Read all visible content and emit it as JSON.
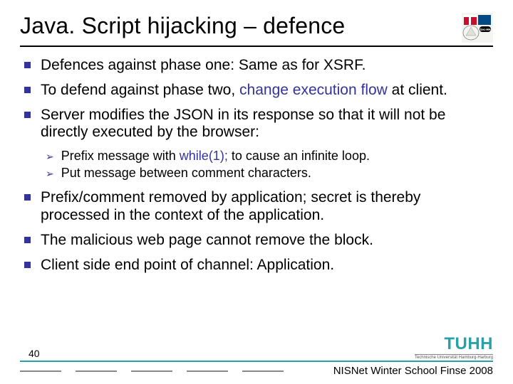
{
  "title": "Java. Script hijacking – defence",
  "bullets": [
    {
      "pre": "Defences against phase one: Same as for XSRF.",
      "accent": "",
      "post": ""
    },
    {
      "pre": "To defend against phase two, ",
      "accent": "change execution flow",
      "post": " at client."
    },
    {
      "pre": "Server modifies the JSON in its response so that it will not be directly executed by the browser:",
      "accent": "",
      "post": ""
    }
  ],
  "sub_bullets": [
    {
      "pre": "Prefix message with ",
      "accent": "while(1);",
      "post": " to cause an infinite loop."
    },
    {
      "pre": "Put message between comment characters.",
      "accent": "",
      "post": ""
    }
  ],
  "bullets2": [
    {
      "pre": "Prefix/comment removed by application; secret is thereby processed in the context of the application.",
      "accent": "",
      "post": ""
    },
    {
      "pre": "The malicious web page cannot remove the block.",
      "accent": "",
      "post": ""
    },
    {
      "pre": "Client side end point of channel: Application.",
      "accent": "",
      "post": ""
    }
  ],
  "page_number": "40",
  "footer_event": "NISNet Winter School Finse 2008",
  "tuhh_label": "TUHH",
  "tuhh_sub": "Technische Universität Hamburg-Harburg",
  "top_logo_label": "Sec-HH"
}
